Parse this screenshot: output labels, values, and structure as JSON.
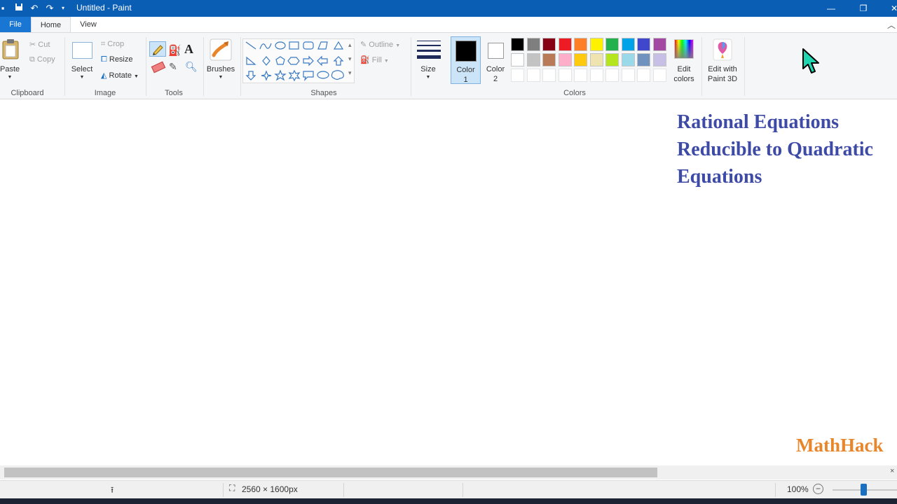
{
  "window": {
    "title": "Untitled - Paint"
  },
  "tabs": [
    {
      "label": "File"
    },
    {
      "label": "Home"
    },
    {
      "label": "View"
    }
  ],
  "clipboard": {
    "paste": "Paste",
    "cut": "Cut",
    "copy": "Copy",
    "group": "Clipboard"
  },
  "image": {
    "select": "Select",
    "crop": "Crop",
    "resize": "Resize",
    "rotate": "Rotate",
    "group": "Image"
  },
  "tools": {
    "group": "Tools"
  },
  "brushes": {
    "label": "Brushes"
  },
  "shapes": {
    "outline": "Outline",
    "fill": "Fill",
    "group": "Shapes"
  },
  "size": {
    "label": "Size"
  },
  "colors": {
    "color1": "Color",
    "color1_num": "1",
    "color2": "Color",
    "color2_num": "2",
    "group": "Colors",
    "edit_colors_1": "Edit",
    "edit_colors_2": "colors",
    "paint3d_1": "Edit with",
    "paint3d_2": "Paint 3D",
    "palette_row1": [
      "#000000",
      "#7f7f7f",
      "#880015",
      "#ed1c24",
      "#ff7f27",
      "#fff200",
      "#22b14c",
      "#00a2e8",
      "#3f48cc",
      "#a349a4"
    ],
    "palette_row2": [
      "#ffffff",
      "#c3c3c3",
      "#b97a57",
      "#ffaec9",
      "#ffc90e",
      "#efe4b0",
      "#b5e61d",
      "#99d9ea",
      "#7092be",
      "#c8bfe7"
    ]
  },
  "canvas": {
    "heading_lines": [
      "Rational Equations",
      "Reducible to Quadratic",
      "Equations"
    ],
    "watermark": "MathHack"
  },
  "status": {
    "dimensions": "2560 × 1600px",
    "zoom": "100%"
  }
}
